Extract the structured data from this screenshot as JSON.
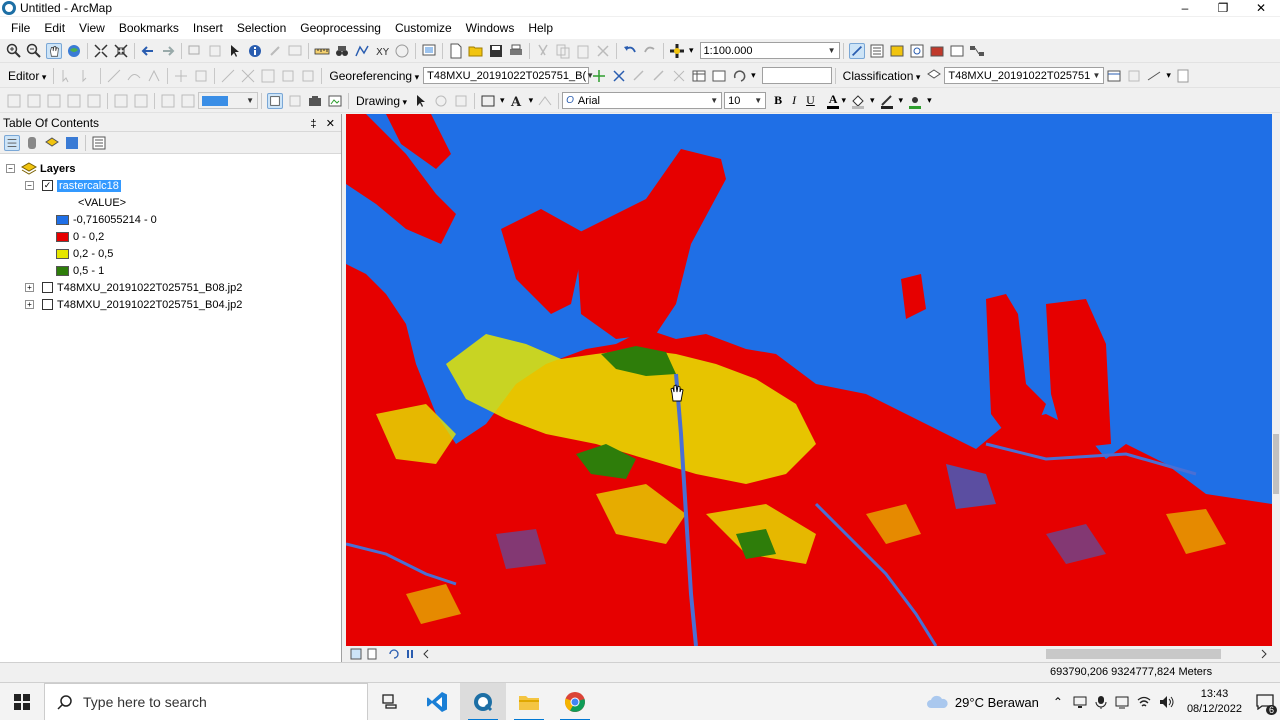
{
  "window": {
    "title": "Untitled - ArcMap",
    "minimize": "–",
    "maximize": "❐",
    "close": "✕"
  },
  "menu": [
    "File",
    "Edit",
    "View",
    "Bookmarks",
    "Insert",
    "Selection",
    "Geoprocessing",
    "Customize",
    "Windows",
    "Help"
  ],
  "toolbar1": {
    "scale": "1:100.000"
  },
  "toolbar2": {
    "editor": "Editor",
    "georeferencing": "Georeferencing",
    "georef_layer": "T48MXU_20191022T025751_B(",
    "classification": "Classification",
    "class_layer": "T48MXU_20191022T025751"
  },
  "toolbar3": {
    "drawing": "Drawing",
    "font": "Arial",
    "font_size": "10",
    "bold": "B",
    "italic": "I",
    "underline": "U",
    "font_color": "A"
  },
  "toc": {
    "title": "Table Of Contents",
    "pin": "‡",
    "close": "✕",
    "layers_label": "Layers",
    "raster_layer": "rastercalc18",
    "value_label": "<VALUE>",
    "legend": [
      {
        "label": "-0,716055214 - 0",
        "color": "#1f6fe6"
      },
      {
        "label": "0 - 0,2",
        "color": "#e60000"
      },
      {
        "label": "0,2 - 0,5",
        "color": "#e6e600"
      },
      {
        "label": "0,5 - 1",
        "color": "#2e7d0a"
      }
    ],
    "other_layers": [
      "T48MXU_20191022T025751_B08.jp2",
      "T48MXU_20191022T025751_B04.jp2"
    ]
  },
  "status": {
    "coordinates": "693790,206  9324777,824 Meters"
  },
  "taskbar": {
    "search_placeholder": "Type here to search",
    "weather": "29°C  Berawan",
    "time": "13:43",
    "date": "08/12/2022",
    "notifications": "6"
  }
}
